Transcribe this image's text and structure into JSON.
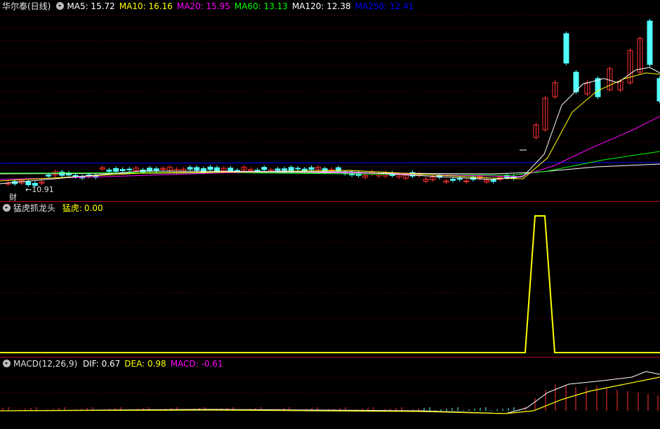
{
  "main": {
    "stock": "华尔泰(日线)",
    "indicators": [
      {
        "key": "MA5",
        "label": "MA5:",
        "value": "15.72",
        "color": "#ffffff"
      },
      {
        "key": "MA10",
        "label": "MA10:",
        "value": "16.16",
        "color": "#ffff00"
      },
      {
        "key": "MA20",
        "label": "MA20:",
        "value": "15.95",
        "color": "#ff00ff"
      },
      {
        "key": "MA60",
        "label": "MA60:",
        "value": "13.13",
        "color": "#00ff00"
      },
      {
        "key": "MA120",
        "label": "MA120:",
        "value": "12.38",
        "color": "#ffffff"
      },
      {
        "key": "MA250",
        "label": "MA250:",
        "value": "12.41",
        "color": "#0000ff"
      }
    ],
    "low_marker": "10.91",
    "cai_tag": "财"
  },
  "sub1": {
    "name": "猛虎抓龙头",
    "series_label": "猛虎:",
    "series_value": "0.00",
    "color": "#ffff00"
  },
  "sub2": {
    "name": "MACD(12,26,9)",
    "items": [
      {
        "label": "DIF:",
        "value": "0.67",
        "color": "#ffffff"
      },
      {
        "label": "DEA:",
        "value": "0.98",
        "color": "#ffff00"
      },
      {
        "label": "MACD:",
        "value": "-0.61",
        "color": "#ff00ff"
      }
    ]
  },
  "colors": {
    "up": "#ff3232",
    "down": "#54ffff",
    "grid": "#7a0000",
    "separator": "#b8001c"
  }
}
